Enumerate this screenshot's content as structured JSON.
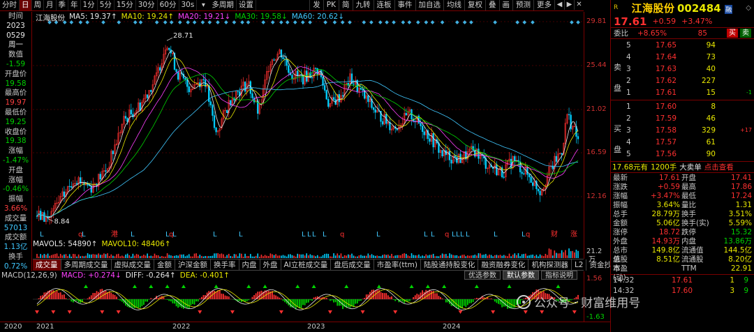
{
  "toolbar": {
    "items": [
      "分时",
      "日",
      "周",
      "月",
      "季",
      "年",
      "1分",
      "5分",
      "15分",
      "30分",
      "60分",
      "30s",
      "多周期",
      "设置"
    ],
    "active_index": 1,
    "right_items": [
      "发",
      "PK",
      "简",
      "九转",
      "连板",
      "事件",
      "加自选",
      "均线",
      "复权",
      "叠",
      "画",
      "预测",
      "更多"
    ]
  },
  "left_panel": {
    "rows": [
      {
        "text": "时间",
        "c": "label"
      },
      {
        "text": "2023",
        "c": "white"
      },
      {
        "text": "0529",
        "c": "white"
      },
      {
        "text": "周一",
        "c": "white"
      },
      {
        "text": "数值",
        "c": "label"
      },
      {
        "text": "-1.59",
        "c": "green"
      },
      {
        "text": "开盘价",
        "c": "label"
      },
      {
        "text": "19.58",
        "c": "green"
      },
      {
        "text": "最高价",
        "c": "label"
      },
      {
        "text": "19.97",
        "c": "red"
      },
      {
        "text": "最低价",
        "c": "label"
      },
      {
        "text": "19.25",
        "c": "green"
      },
      {
        "text": "收盘价",
        "c": "label"
      },
      {
        "text": "19.38",
        "c": "green"
      },
      {
        "text": "涨幅",
        "c": "label"
      },
      {
        "text": "-1.47%",
        "c": "green"
      },
      {
        "text": "开盘",
        "c": "label"
      },
      {
        "text": "涨幅",
        "c": "label"
      },
      {
        "text": "-0.46%",
        "c": "green"
      },
      {
        "text": "振幅",
        "c": "label"
      },
      {
        "text": "3.66%",
        "c": "red"
      },
      {
        "text": "成交量",
        "c": "label"
      },
      {
        "text": "57013",
        "c": "blue"
      },
      {
        "text": "成交额",
        "c": "label"
      },
      {
        "text": "1.13亿",
        "c": "blue"
      },
      {
        "text": "换手",
        "c": "label"
      },
      {
        "text": "0.72%",
        "c": "blue"
      }
    ]
  },
  "ma_legend": [
    {
      "text": "江海股份",
      "color": "#e8e8e8"
    },
    {
      "text": "MA5: 19.37↑",
      "color": "#e8e8e8"
    },
    {
      "text": "MA10: 19.24↑",
      "color": "#e8e800"
    },
    {
      "text": "MA20: 19.21↓",
      "color": "#ff40ff"
    },
    {
      "text": "MA30: 19.58↓",
      "color": "#00d200"
    },
    {
      "text": "MA60: 20.62↓",
      "color": "#40c8ff"
    }
  ],
  "price_axis": [
    "29.81",
    "25.44",
    "21.02",
    "16.59",
    "12.16"
  ],
  "annotations": {
    "high": "28.71",
    "low": "8.84"
  },
  "event_markers": [
    "L",
    "q",
    "L",
    "港",
    "L",
    "L",
    "q",
    "L",
    "L",
    "L",
    "L",
    "L",
    "L",
    "L",
    "q",
    "L",
    "L",
    "L",
    "q",
    "L",
    "L",
    "L",
    "L",
    "L",
    "L",
    "q",
    "财",
    "涨"
  ],
  "vol_legend": [
    {
      "text": "MAVOL5: 54890↑",
      "color": "#e8e8e8"
    },
    {
      "text": "MAVOL10: 48406↑",
      "color": "#e8e800"
    }
  ],
  "vol_axis": [
    "21.2",
    "万"
  ],
  "tabs": [
    "成交量",
    "多周期成交量",
    "虚拟成交量",
    "金额",
    "沪深金额",
    "换手率",
    "内盘",
    "外盘",
    "AI立桩成交量",
    "盘后成交量",
    "市盈率(ttm)",
    "陆股通持股变化",
    "融资融券变化",
    "机构探测器",
    "L2",
    "资金抄底"
  ],
  "tabs_active": 0,
  "macd_legend": [
    {
      "text": "MACD(12,26,9)",
      "color": "#c8c8c8"
    },
    {
      "text": "MACD: +0.274↓",
      "color": "#ff40ff"
    },
    {
      "text": "DIFF: -0.264↑",
      "color": "#e8e8e8"
    },
    {
      "text": "DEA: -0.401↑",
      "color": "#e8e800"
    }
  ],
  "macd_buttons": [
    "优选参数",
    "默认参数",
    "指标说明"
  ],
  "macd_axis": [
    "1.56",
    "-1.63"
  ],
  "date_axis": [
    "2020",
    "2021",
    "2022",
    "2023",
    "2024"
  ],
  "quote": {
    "marker": "R",
    "name": "江海股份",
    "code": "002484",
    "badge": "融",
    "price": "17.61",
    "change": "+0.59",
    "pct": "+3.47%",
    "weibi_label": "委比",
    "weibi": "+8.65%",
    "weicha": "85",
    "buy_btn": "买",
    "sell_btn": "卖",
    "ask_label": "卖盘",
    "bid_label": "买盘",
    "asks": [
      {
        "lvl": "5",
        "price": "17.65",
        "vol": "94",
        "chg": ""
      },
      {
        "lvl": "4",
        "price": "17.64",
        "vol": "73",
        "chg": ""
      },
      {
        "lvl": "3",
        "price": "17.63",
        "vol": "40",
        "chg": ""
      },
      {
        "lvl": "2",
        "price": "17.62",
        "vol": "227",
        "chg": ""
      },
      {
        "lvl": "1",
        "price": "17.61",
        "vol": "15",
        "chg": "-1"
      }
    ],
    "bids": [
      {
        "lvl": "1",
        "price": "17.60",
        "vol": "8",
        "chg": ""
      },
      {
        "lvl": "2",
        "price": "17.59",
        "vol": "46",
        "chg": ""
      },
      {
        "lvl": "3",
        "price": "17.58",
        "vol": "329",
        "chg": "+17"
      },
      {
        "lvl": "4",
        "price": "17.57",
        "vol": "61",
        "chg": ""
      },
      {
        "lvl": "5",
        "price": "17.56",
        "vol": "90",
        "chg": ""
      }
    ],
    "banner": {
      "price": "17.68元有",
      "vol": "1200手",
      "label": "大卖单",
      "link": "点击查看"
    },
    "stats": [
      {
        "k1": "最新",
        "v1": "17.61",
        "c1": "red",
        "k2": "开盘",
        "v2": "17.41",
        "c2": "red"
      },
      {
        "k1": "涨跌",
        "v1": "+0.59",
        "c1": "red",
        "k2": "最高",
        "v2": "17.86",
        "c2": "red"
      },
      {
        "k1": "涨幅",
        "v1": "+3.47%",
        "c1": "red",
        "k2": "最低",
        "v2": "17.24",
        "c2": "red"
      },
      {
        "k1": "振幅",
        "v1": "3.64%",
        "c1": "yellow",
        "k2": "量比",
        "v2": "1.31",
        "c2": "yellow"
      },
      {
        "k1": "总手",
        "v1": "28.79万",
        "c1": "yellow",
        "k2": "换手",
        "v2": "3.51%",
        "c2": "yellow"
      },
      {
        "k1": "金额",
        "v1": "5.06亿",
        "c1": "yellow",
        "k2": "换手(实)",
        "v2": "5.59%",
        "c2": "yellow"
      },
      {
        "k1": "涨停",
        "v1": "18.72",
        "c1": "red",
        "k2": "跌停",
        "v2": "15.32",
        "c2": "green"
      },
      {
        "k1": "外盘",
        "v1": "14.93万",
        "c1": "red",
        "k2": "内盘",
        "v2": "13.86万",
        "c2": "green"
      },
      {
        "k1": "总市值",
        "v1": "149.8亿",
        "c1": "yellow",
        "k2": "流通值",
        "v2": "144.5亿",
        "c2": "yellow"
      },
      {
        "k1": "总股本",
        "v1": "8.51亿",
        "c1": "yellow",
        "k2": "流通股",
        "v2": "8.20亿",
        "c2": "yellow"
      },
      {
        "k1": "市盈(动)",
        "v1": "",
        "c1": "yellow",
        "k2": "TTM",
        "v2": "22.91",
        "c2": "yellow"
      }
    ],
    "ticks": [
      {
        "t": "14:32",
        "p": "17.61",
        "pc": "red",
        "v": "1",
        "f": "9",
        "fc": "green"
      },
      {
        "t": "14:32",
        "p": "17.60",
        "pc": "red",
        "v": "3",
        "f": "9",
        "fc": "green"
      }
    ]
  },
  "watermark": "公众号 · 财富维用号"
}
